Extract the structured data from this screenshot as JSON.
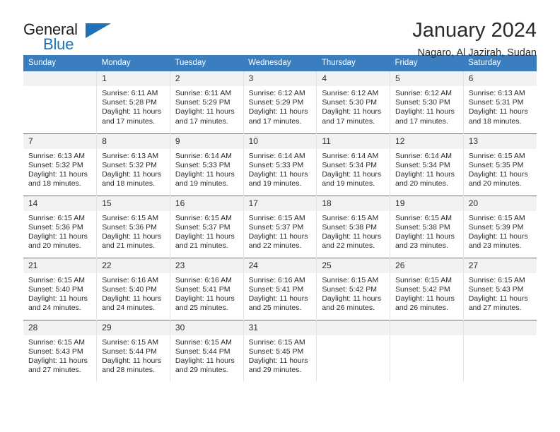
{
  "brand": {
    "line1": "General",
    "line2": "Blue",
    "triangle_icon": "blue-triangle-icon",
    "accent_color": "#1d72b8"
  },
  "header": {
    "month_title": "January 2024",
    "location": "Nagaro, Al Jazirah, Sudan"
  },
  "theme": {
    "header_blue": "#3a7ebf",
    "daynum_band": "#f2f2f2",
    "cell_border": "#e3e3e3",
    "text": "#2b2b2b"
  },
  "weekday_headers": [
    "Sunday",
    "Monday",
    "Tuesday",
    "Wednesday",
    "Thursday",
    "Friday",
    "Saturday"
  ],
  "labels": {
    "sunrise_prefix": "Sunrise:",
    "sunset_prefix": "Sunset:",
    "daylight_prefix": "Daylight:"
  },
  "weeks": [
    [
      {
        "day": "",
        "blank": true
      },
      {
        "day": "1",
        "sunrise": "Sunrise: 6:11 AM",
        "sunset": "Sunset: 5:28 PM",
        "daylight_1": "Daylight: 11 hours",
        "daylight_2": "and 17 minutes."
      },
      {
        "day": "2",
        "sunrise": "Sunrise: 6:11 AM",
        "sunset": "Sunset: 5:29 PM",
        "daylight_1": "Daylight: 11 hours",
        "daylight_2": "and 17 minutes."
      },
      {
        "day": "3",
        "sunrise": "Sunrise: 6:12 AM",
        "sunset": "Sunset: 5:29 PM",
        "daylight_1": "Daylight: 11 hours",
        "daylight_2": "and 17 minutes."
      },
      {
        "day": "4",
        "sunrise": "Sunrise: 6:12 AM",
        "sunset": "Sunset: 5:30 PM",
        "daylight_1": "Daylight: 11 hours",
        "daylight_2": "and 17 minutes."
      },
      {
        "day": "5",
        "sunrise": "Sunrise: 6:12 AM",
        "sunset": "Sunset: 5:30 PM",
        "daylight_1": "Daylight: 11 hours",
        "daylight_2": "and 17 minutes."
      },
      {
        "day": "6",
        "sunrise": "Sunrise: 6:13 AM",
        "sunset": "Sunset: 5:31 PM",
        "daylight_1": "Daylight: 11 hours",
        "daylight_2": "and 18 minutes."
      }
    ],
    [
      {
        "day": "7",
        "sunrise": "Sunrise: 6:13 AM",
        "sunset": "Sunset: 5:32 PM",
        "daylight_1": "Daylight: 11 hours",
        "daylight_2": "and 18 minutes."
      },
      {
        "day": "8",
        "sunrise": "Sunrise: 6:13 AM",
        "sunset": "Sunset: 5:32 PM",
        "daylight_1": "Daylight: 11 hours",
        "daylight_2": "and 18 minutes."
      },
      {
        "day": "9",
        "sunrise": "Sunrise: 6:14 AM",
        "sunset": "Sunset: 5:33 PM",
        "daylight_1": "Daylight: 11 hours",
        "daylight_2": "and 19 minutes."
      },
      {
        "day": "10",
        "sunrise": "Sunrise: 6:14 AM",
        "sunset": "Sunset: 5:33 PM",
        "daylight_1": "Daylight: 11 hours",
        "daylight_2": "and 19 minutes."
      },
      {
        "day": "11",
        "sunrise": "Sunrise: 6:14 AM",
        "sunset": "Sunset: 5:34 PM",
        "daylight_1": "Daylight: 11 hours",
        "daylight_2": "and 19 minutes."
      },
      {
        "day": "12",
        "sunrise": "Sunrise: 6:14 AM",
        "sunset": "Sunset: 5:34 PM",
        "daylight_1": "Daylight: 11 hours",
        "daylight_2": "and 20 minutes."
      },
      {
        "day": "13",
        "sunrise": "Sunrise: 6:15 AM",
        "sunset": "Sunset: 5:35 PM",
        "daylight_1": "Daylight: 11 hours",
        "daylight_2": "and 20 minutes."
      }
    ],
    [
      {
        "day": "14",
        "sunrise": "Sunrise: 6:15 AM",
        "sunset": "Sunset: 5:36 PM",
        "daylight_1": "Daylight: 11 hours",
        "daylight_2": "and 20 minutes."
      },
      {
        "day": "15",
        "sunrise": "Sunrise: 6:15 AM",
        "sunset": "Sunset: 5:36 PM",
        "daylight_1": "Daylight: 11 hours",
        "daylight_2": "and 21 minutes."
      },
      {
        "day": "16",
        "sunrise": "Sunrise: 6:15 AM",
        "sunset": "Sunset: 5:37 PM",
        "daylight_1": "Daylight: 11 hours",
        "daylight_2": "and 21 minutes."
      },
      {
        "day": "17",
        "sunrise": "Sunrise: 6:15 AM",
        "sunset": "Sunset: 5:37 PM",
        "daylight_1": "Daylight: 11 hours",
        "daylight_2": "and 22 minutes."
      },
      {
        "day": "18",
        "sunrise": "Sunrise: 6:15 AM",
        "sunset": "Sunset: 5:38 PM",
        "daylight_1": "Daylight: 11 hours",
        "daylight_2": "and 22 minutes."
      },
      {
        "day": "19",
        "sunrise": "Sunrise: 6:15 AM",
        "sunset": "Sunset: 5:38 PM",
        "daylight_1": "Daylight: 11 hours",
        "daylight_2": "and 23 minutes."
      },
      {
        "day": "20",
        "sunrise": "Sunrise: 6:15 AM",
        "sunset": "Sunset: 5:39 PM",
        "daylight_1": "Daylight: 11 hours",
        "daylight_2": "and 23 minutes."
      }
    ],
    [
      {
        "day": "21",
        "sunrise": "Sunrise: 6:15 AM",
        "sunset": "Sunset: 5:40 PM",
        "daylight_1": "Daylight: 11 hours",
        "daylight_2": "and 24 minutes."
      },
      {
        "day": "22",
        "sunrise": "Sunrise: 6:16 AM",
        "sunset": "Sunset: 5:40 PM",
        "daylight_1": "Daylight: 11 hours",
        "daylight_2": "and 24 minutes."
      },
      {
        "day": "23",
        "sunrise": "Sunrise: 6:16 AM",
        "sunset": "Sunset: 5:41 PM",
        "daylight_1": "Daylight: 11 hours",
        "daylight_2": "and 25 minutes."
      },
      {
        "day": "24",
        "sunrise": "Sunrise: 6:16 AM",
        "sunset": "Sunset: 5:41 PM",
        "daylight_1": "Daylight: 11 hours",
        "daylight_2": "and 25 minutes."
      },
      {
        "day": "25",
        "sunrise": "Sunrise: 6:15 AM",
        "sunset": "Sunset: 5:42 PM",
        "daylight_1": "Daylight: 11 hours",
        "daylight_2": "and 26 minutes."
      },
      {
        "day": "26",
        "sunrise": "Sunrise: 6:15 AM",
        "sunset": "Sunset: 5:42 PM",
        "daylight_1": "Daylight: 11 hours",
        "daylight_2": "and 26 minutes."
      },
      {
        "day": "27",
        "sunrise": "Sunrise: 6:15 AM",
        "sunset": "Sunset: 5:43 PM",
        "daylight_1": "Daylight: 11 hours",
        "daylight_2": "and 27 minutes."
      }
    ],
    [
      {
        "day": "28",
        "sunrise": "Sunrise: 6:15 AM",
        "sunset": "Sunset: 5:43 PM",
        "daylight_1": "Daylight: 11 hours",
        "daylight_2": "and 27 minutes."
      },
      {
        "day": "29",
        "sunrise": "Sunrise: 6:15 AM",
        "sunset": "Sunset: 5:44 PM",
        "daylight_1": "Daylight: 11 hours",
        "daylight_2": "and 28 minutes."
      },
      {
        "day": "30",
        "sunrise": "Sunrise: 6:15 AM",
        "sunset": "Sunset: 5:44 PM",
        "daylight_1": "Daylight: 11 hours",
        "daylight_2": "and 29 minutes."
      },
      {
        "day": "31",
        "sunrise": "Sunrise: 6:15 AM",
        "sunset": "Sunset: 5:45 PM",
        "daylight_1": "Daylight: 11 hours",
        "daylight_2": "and 29 minutes."
      },
      {
        "day": "",
        "blank": true
      },
      {
        "day": "",
        "blank": true
      },
      {
        "day": "",
        "blank": true
      }
    ]
  ]
}
